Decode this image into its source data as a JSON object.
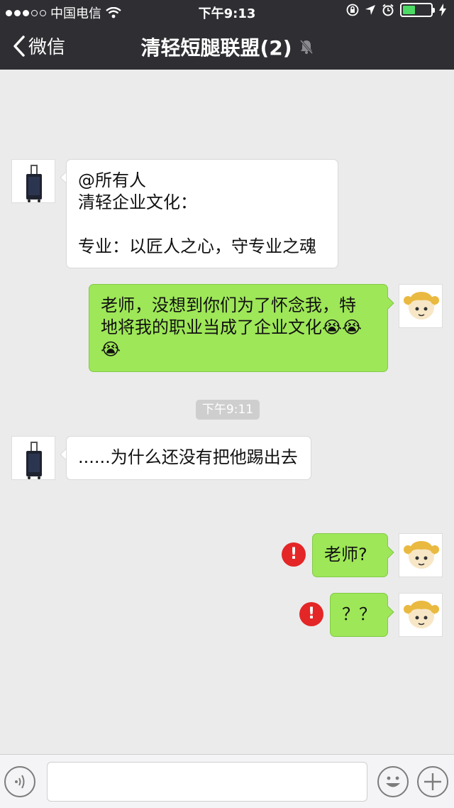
{
  "status_bar": {
    "carrier": "中国电信",
    "time": "下午9:13"
  },
  "nav": {
    "back_label": "微信",
    "title": "清轻短腿联盟(2)"
  },
  "messages": [
    {
      "side": "left",
      "lines": [
        "@所有人",
        "清轻企业文化：",
        "",
        "专业：以匠人之心，守专业之魂"
      ]
    },
    {
      "side": "right",
      "lines": [
        "老师，没想到你们为了怀念我，特",
        "地将我的职业当成了企业文化😭😭",
        "😭"
      ]
    },
    {
      "side": "left",
      "lines": [
        "......为什么还没有把他踢出去"
      ]
    },
    {
      "side": "right",
      "lines": [
        "老师?"
      ],
      "failed": true
    },
    {
      "side": "right",
      "lines": [
        "？？"
      ],
      "failed": true
    }
  ],
  "timestamp": "下午9:11",
  "error_mark": "!",
  "colors": {
    "nav_bg": "#2e2e33",
    "chat_bg": "#ebebeb",
    "green_bubble": "#9ee758",
    "error": "#e42626"
  },
  "icons": {
    "back": "chevron-left-icon",
    "mute": "bell-off-icon",
    "voice": "voice-icon",
    "emoji": "smiley-icon",
    "more": "plus-icon"
  }
}
